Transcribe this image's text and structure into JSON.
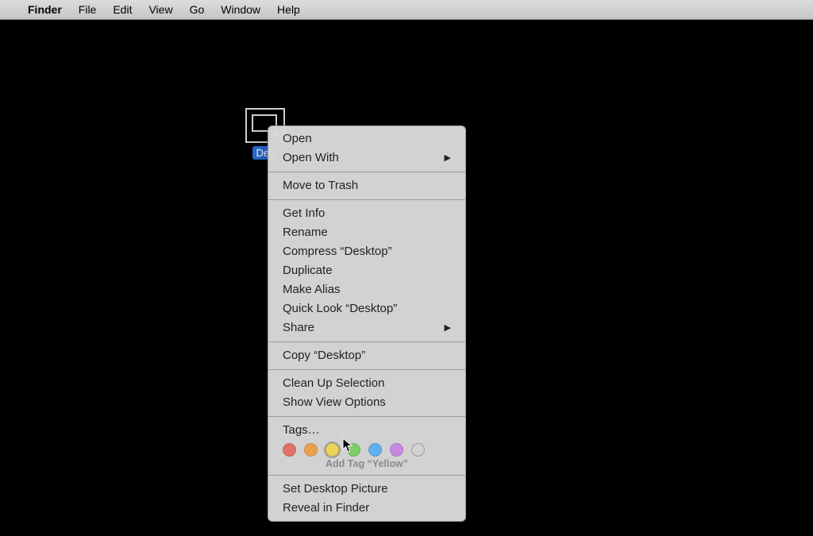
{
  "menubar": {
    "app": "Finder",
    "items": [
      "File",
      "Edit",
      "View",
      "Go",
      "Window",
      "Help"
    ]
  },
  "desktop": {
    "icon_label": "Des"
  },
  "context_menu": {
    "groups": [
      [
        {
          "label": "Open",
          "submenu": false
        },
        {
          "label": "Open With",
          "submenu": true
        }
      ],
      [
        {
          "label": "Move to Trash",
          "submenu": false
        }
      ],
      [
        {
          "label": "Get Info",
          "submenu": false
        },
        {
          "label": "Rename",
          "submenu": false
        },
        {
          "label": "Compress “Desktop”",
          "submenu": false
        },
        {
          "label": "Duplicate",
          "submenu": false
        },
        {
          "label": "Make Alias",
          "submenu": false
        },
        {
          "label": "Quick Look “Desktop”",
          "submenu": false
        },
        {
          "label": "Share",
          "submenu": true
        }
      ],
      [
        {
          "label": "Copy “Desktop”",
          "submenu": false
        }
      ],
      [
        {
          "label": "Clean Up Selection",
          "submenu": false
        },
        {
          "label": "Show View Options",
          "submenu": false
        }
      ],
      [
        {
          "label": "Tags…",
          "submenu": false
        }
      ],
      [
        {
          "label": "Set Desktop Picture",
          "submenu": false
        },
        {
          "label": "Reveal in Finder",
          "submenu": false
        }
      ]
    ],
    "tags": {
      "colors": [
        "#e27266",
        "#e8a24b",
        "#ecd35a",
        "#7ecb6c",
        "#64aef2",
        "#c58ae0"
      ],
      "hint": "Add Tag “Yellow”",
      "hovered_index": 2
    }
  }
}
